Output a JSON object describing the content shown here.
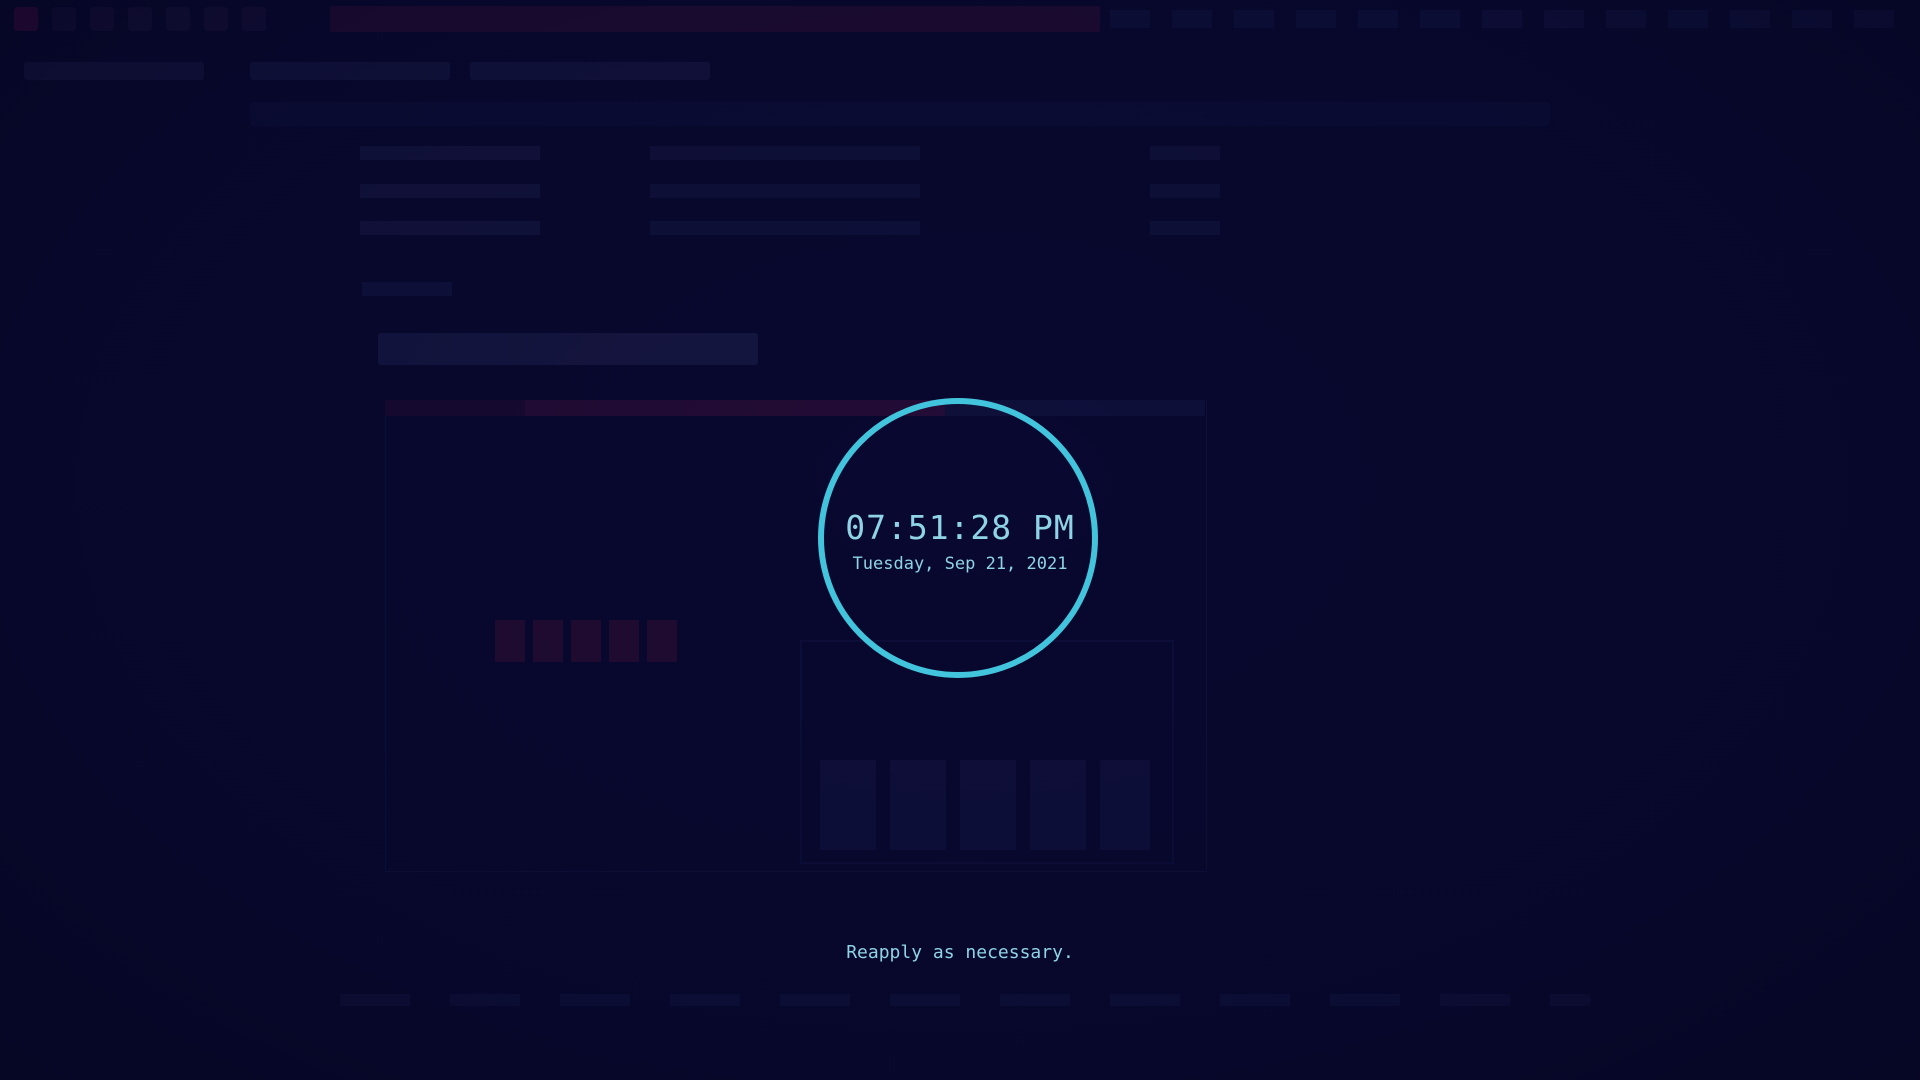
{
  "lockscreen": {
    "time": "07:51:28 PM",
    "date": "Tuesday, Sep 21, 2021",
    "message": "Reapply as necessary."
  },
  "colors": {
    "background": "#08082f",
    "ring": "#42c4dc",
    "text": "#8fd4e6",
    "accent": "#c21a6e"
  }
}
